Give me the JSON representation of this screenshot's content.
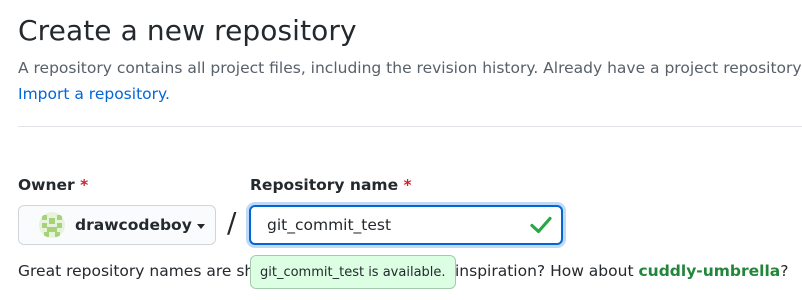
{
  "header": {
    "title": "Create a new repository",
    "subtitle": "A repository contains all project files, including the revision history. Already have a project repository elsewhere?",
    "import_link": "Import a repository."
  },
  "form": {
    "owner_label": "Owner",
    "repo_label": "Repository name",
    "required_mark": "*",
    "owner_value": "drawcodeboy",
    "separator": "/",
    "repo_value": "git_commit_test",
    "availability_message": "git_commit_test is available.",
    "hint_prefix": "Great repository names are short and memorable. Need inspiration? How about ",
    "hint_visible_left": "Great repository names are sh",
    "hint_visible_right": "inspiration? How about ",
    "suggestion": "cuddly-umbrella",
    "hint_suffix": "?"
  },
  "icons": {
    "owner_avatar": "identicon-avatar",
    "dropdown": "caret-down-icon",
    "valid": "check-icon"
  },
  "colors": {
    "link": "#0366d6",
    "required": "#cb2431",
    "success": "#28a745",
    "suggestion": "#22863a",
    "tooltip_bg": "#dcffe4",
    "focus_border": "#0366d6"
  }
}
